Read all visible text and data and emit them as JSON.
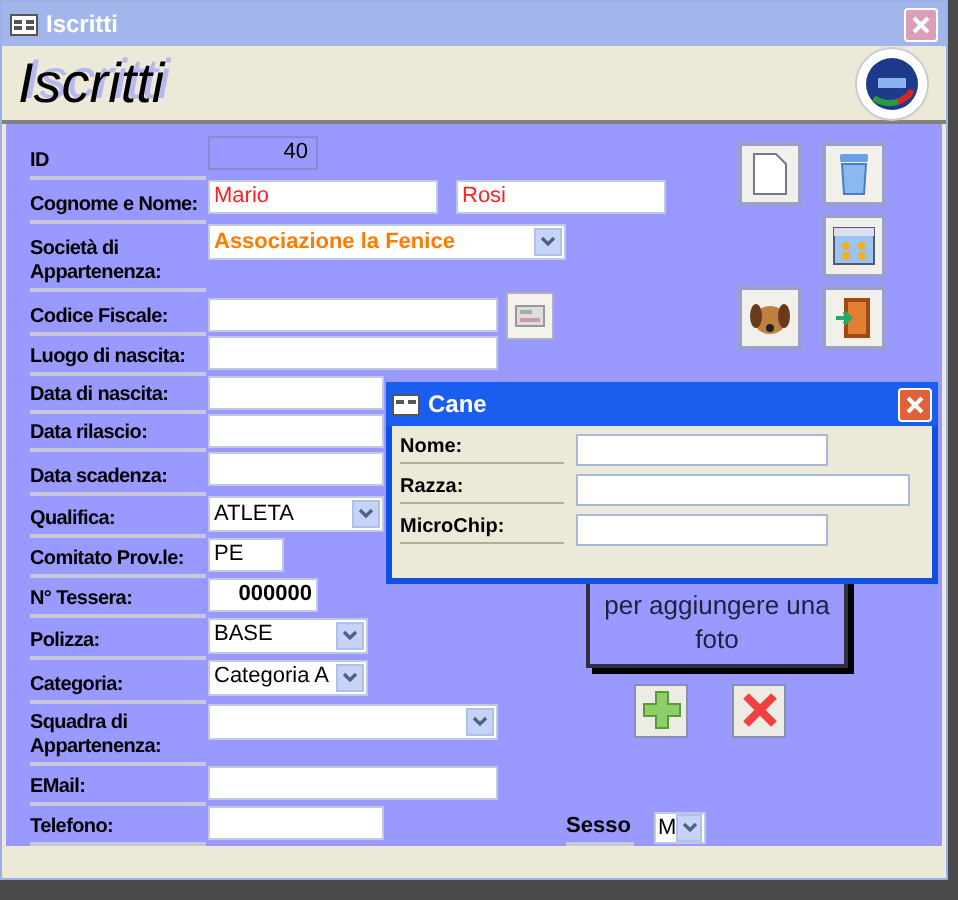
{
  "window": {
    "title": "Iscritti"
  },
  "header": {
    "title": "Iscritti"
  },
  "fields": [
    {
      "kind": "readonly",
      "label": "ID",
      "value": "40"
    },
    {
      "kind": "pair",
      "label": "Cognome e Nome:",
      "value": "Mario",
      "value2": "Rosi",
      "color": "#ff2020"
    },
    {
      "kind": "select",
      "label": "Società di Appartenenza:",
      "value": "Associazione la Fenice",
      "color": "#ff7a00"
    },
    {
      "kind": "lookup",
      "label": "Codice Fiscale:"
    },
    {
      "kind": "text",
      "label": "Luogo di nascita:"
    },
    {
      "kind": "text",
      "label": "Data di nascita:"
    },
    {
      "kind": "text",
      "label": "Data rilascio:"
    },
    {
      "kind": "text",
      "label": "Data scadenza:"
    },
    {
      "kind": "select",
      "label": "Qualifica:",
      "value": "ATLETA"
    },
    {
      "kind": "text",
      "label": "Comitato Prov.le:",
      "value": "PE"
    },
    {
      "kind": "number",
      "label": "N° Tessera:",
      "value": "000000"
    },
    {
      "kind": "select",
      "label": "Polizza:",
      "value": "BASE"
    },
    {
      "kind": "select",
      "label": "Categoria:",
      "value": "Categoria A"
    },
    {
      "kind": "select",
      "label": "Squadra di Appartenenza:"
    },
    {
      "kind": "text",
      "label": "EMail:"
    },
    {
      "kind": "text",
      "label": "Telefono:"
    }
  ],
  "photo": {
    "text": "per aggiungere una foto"
  },
  "sesso": {
    "label": "Sesso",
    "value": "M"
  },
  "dialog": {
    "title": "Cane",
    "fields": [
      {
        "label": "Nome:"
      },
      {
        "label": "Razza:"
      },
      {
        "label": "MicroChip:"
      }
    ]
  }
}
